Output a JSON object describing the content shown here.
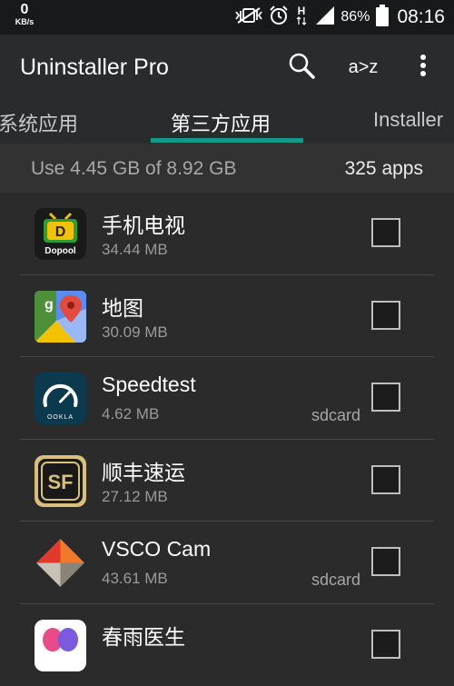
{
  "status_bar": {
    "net_speed": "0",
    "net_unit": "KB/s",
    "battery_pct": "86%",
    "time": "08:16"
  },
  "app_bar": {
    "title": "Uninstaller Pro",
    "sort_label": "a>z"
  },
  "tabs": [
    {
      "label": "系统应用",
      "selected": false
    },
    {
      "label": "第三方应用",
      "selected": true
    },
    {
      "label": "Installer",
      "selected": false
    }
  ],
  "summary": {
    "usage": "Use 4.45 GB of 8.92 GB",
    "count": "325 apps"
  },
  "apps": [
    {
      "name": "手机电视",
      "size": "34.44 MB",
      "location": "",
      "checked": false,
      "icon": "dopool-icon"
    },
    {
      "name": "地图",
      "size": "30.09 MB",
      "location": "",
      "checked": false,
      "icon": "maps-icon"
    },
    {
      "name": "Speedtest",
      "size": "4.62 MB",
      "location": "sdcard",
      "checked": false,
      "icon": "speedtest-icon"
    },
    {
      "name": "顺丰速运",
      "size": "27.12 MB",
      "location": "",
      "checked": false,
      "icon": "sf-express-icon"
    },
    {
      "name": "VSCO Cam",
      "size": "43.61 MB",
      "location": "sdcard",
      "checked": false,
      "icon": "vsco-icon"
    },
    {
      "name": "春雨医生",
      "size": "",
      "location": "",
      "checked": false,
      "icon": "chunyu-icon"
    }
  ],
  "icon_labels": {
    "dopool_text": "Dopool",
    "dopool_letter": "D",
    "maps_letter": "g",
    "speedtest_text": "OOKLA",
    "sf_text": "SF"
  },
  "colors": {
    "accent": "#149a89",
    "background": "#2b2b2b",
    "toolbar": "#2a2b2d",
    "status_bar": "#18191b"
  }
}
